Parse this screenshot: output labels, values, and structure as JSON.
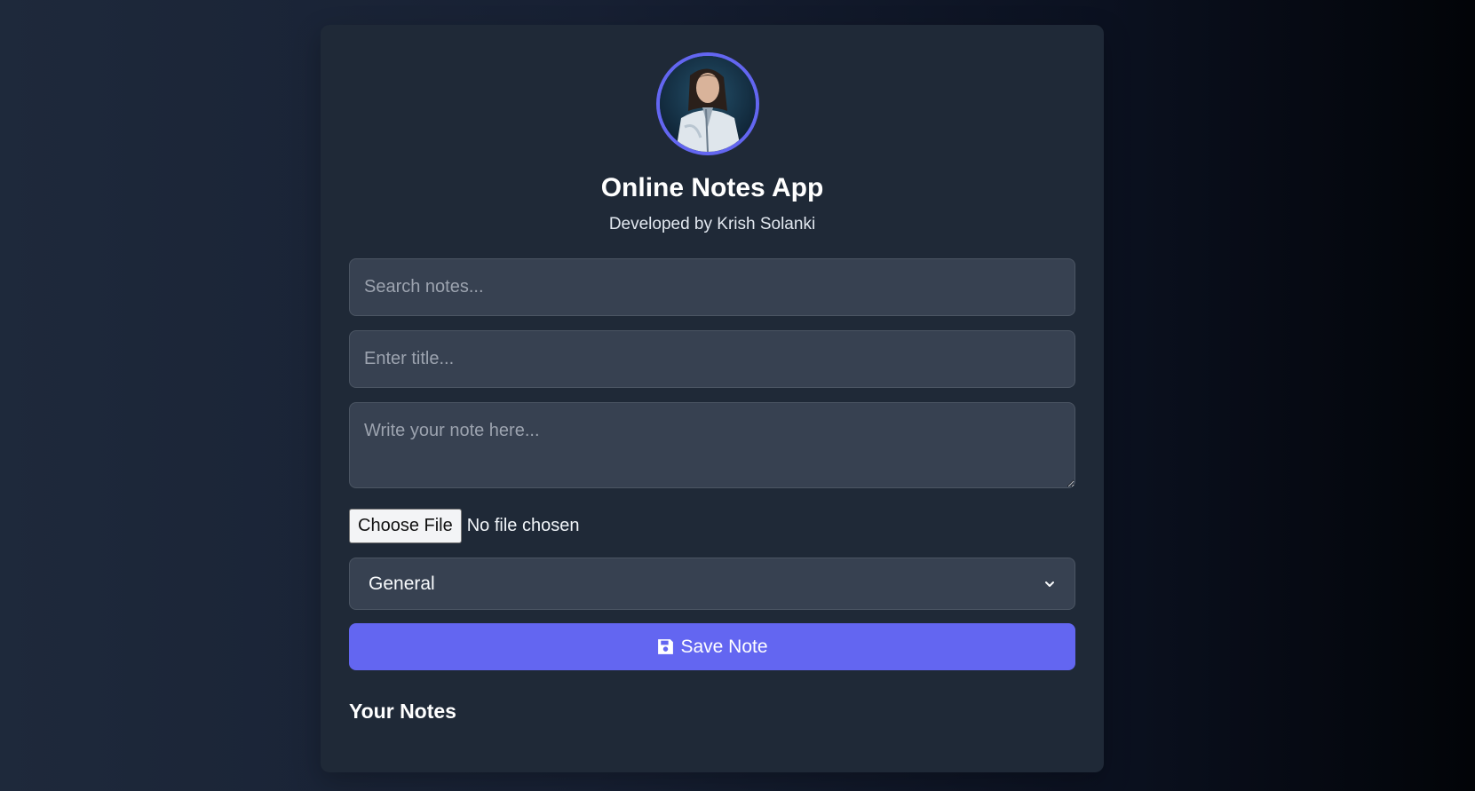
{
  "app": {
    "title": "Online Notes App",
    "subtitle": "Developed by Krish Solanki"
  },
  "form": {
    "search_placeholder": "Search notes...",
    "title_placeholder": "Enter title...",
    "note_placeholder": "Write your note here...",
    "file_button_label": "Choose File",
    "file_status": "No file chosen",
    "category_selected": "General",
    "save_label": "Save Note",
    "save_icon": "floppy-disk-icon"
  },
  "notes": {
    "heading": "Your Notes",
    "items": []
  },
  "colors": {
    "accent": "#6366f1",
    "card": "#1f2937",
    "input": "#374151"
  }
}
